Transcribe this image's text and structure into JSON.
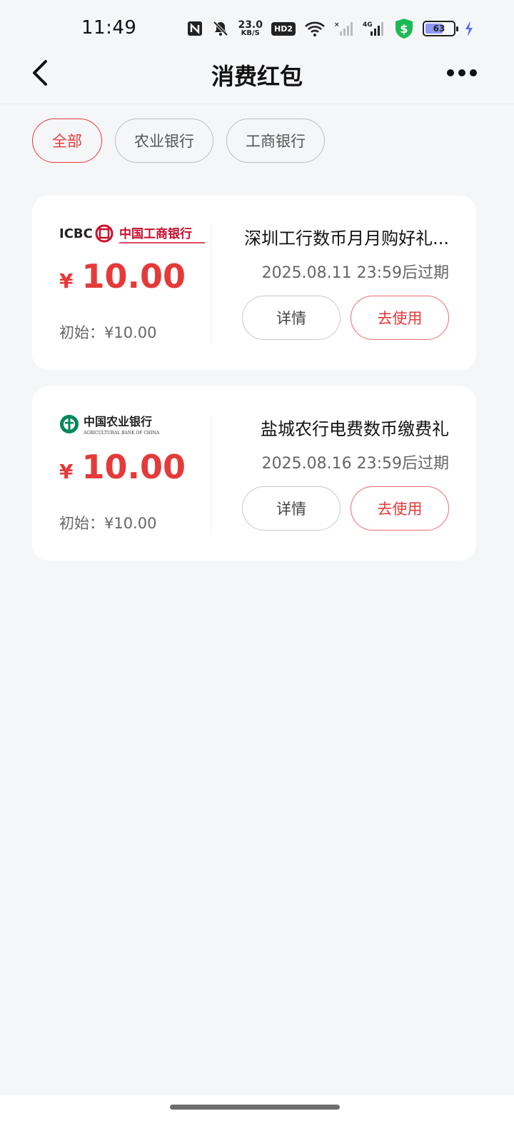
{
  "status_bar": {
    "time": "11:49",
    "net_speed_value": "23.0",
    "net_speed_unit": "KB/S",
    "hd_label": "HD2",
    "network_label": "4G",
    "battery_level": "63",
    "battery_fraction": 0.63,
    "icons": [
      "nfc-icon",
      "mute-icon",
      "hd-icon",
      "wifi-icon",
      "signal-icon",
      "signal-4g-icon",
      "security-icon",
      "battery-icon",
      "charging-icon"
    ]
  },
  "header": {
    "title": "消费红包",
    "back_icon": "chevron-left-icon",
    "more_icon": "more-icon"
  },
  "filters": [
    {
      "label": "全部",
      "active": true
    },
    {
      "label": "农业银行",
      "active": false
    },
    {
      "label": "工商银行",
      "active": false
    }
  ],
  "cards": [
    {
      "bank": "icbc",
      "logo_text_en": "ICBC",
      "logo_text_cn": "中国工商银行",
      "currency": "¥",
      "amount": "10.00",
      "initial": "初始：¥10.00",
      "title": "深圳工行数币月月购好礼...",
      "expiry": "2025.08.11 23:59后过期",
      "detail_label": "详情",
      "use_label": "去使用"
    },
    {
      "bank": "abc",
      "logo_text_cn": "中国农业银行",
      "logo_text_en": "AGRICULTURAL BANK OF CHINA",
      "currency": "¥",
      "amount": "10.00",
      "initial": "初始：¥10.00",
      "title": "盐城农行电费数币缴费礼",
      "expiry": "2025.08.16 23:59后过期",
      "detail_label": "详情",
      "use_label": "去使用"
    }
  ],
  "colors": {
    "accent_red": "#e53a3a",
    "icbc_red": "#c8102e",
    "abc_green": "#00875a",
    "background": "#f5f6f8"
  }
}
